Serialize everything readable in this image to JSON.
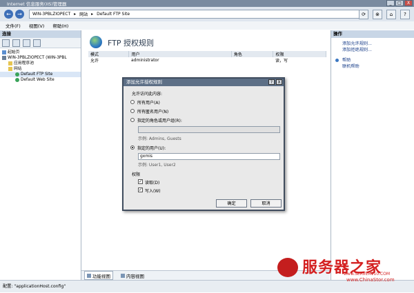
{
  "window": {
    "title": "Internet 信息服务(IIS)管理器",
    "min": "_",
    "max": "□",
    "close": "X"
  },
  "address": {
    "back": "←",
    "forward": "→",
    "path": [
      "WIN-3PBLZIOPECT",
      "网站",
      "Default FTP Site"
    ],
    "sep": "▸",
    "buttons": [
      "⟳",
      "⊗",
      "⌂",
      "?"
    ]
  },
  "menu": [
    "文件(F)",
    "视图(V)",
    "帮助(H)"
  ],
  "connections": {
    "header": "连接",
    "tree": [
      {
        "label": "起始页",
        "icon": "home-icon"
      },
      {
        "label": "WIN-3PBLZIOPECT (WIN-3PBL",
        "icon": "server-icon"
      },
      {
        "label": "应用程序池",
        "icon": "folder-icon"
      },
      {
        "label": "网站",
        "icon": "folder-icon"
      },
      {
        "label": "Default FTP Site",
        "icon": "globe-icon"
      },
      {
        "label": "Default Web Site",
        "icon": "globe-icon"
      }
    ]
  },
  "main": {
    "title": "FTP 授权规则",
    "columns": [
      "模式",
      "用户",
      "角色",
      "权限"
    ],
    "rows": [
      [
        "允许",
        "administrator",
        "",
        "读，写"
      ]
    ],
    "tabs": [
      "功能视图",
      "内容视图"
    ]
  },
  "actions": {
    "header": "操作",
    "items": [
      "添加允许规则...",
      "添加拒绝规则...",
      "帮助",
      "联机帮助"
    ]
  },
  "dialog": {
    "title": "添加允许授权规则",
    "help": "?",
    "close": "X",
    "allow_access_label": "允许访问此内容:",
    "opt_all": "所有用户(A)",
    "opt_anon": "所有匿名用户(N)",
    "opt_roles": "指定的角色或用户组(R):",
    "roles_value": "",
    "roles_example": "示例: Admins, Guests",
    "opt_users": "指定的用户(U):",
    "users_value": "gxmis",
    "users_example": "示例: User1, User2",
    "perm_label": "权限",
    "read": "读取(D)",
    "write": "写入(W)",
    "ok": "确定",
    "cancel": "取消"
  },
  "status": "配置: \"applicationHost.config\"",
  "watermark": {
    "title": "服务器之家",
    "url": "www.SERVER110.COM",
    "site": "www.ChinaStor.com"
  }
}
